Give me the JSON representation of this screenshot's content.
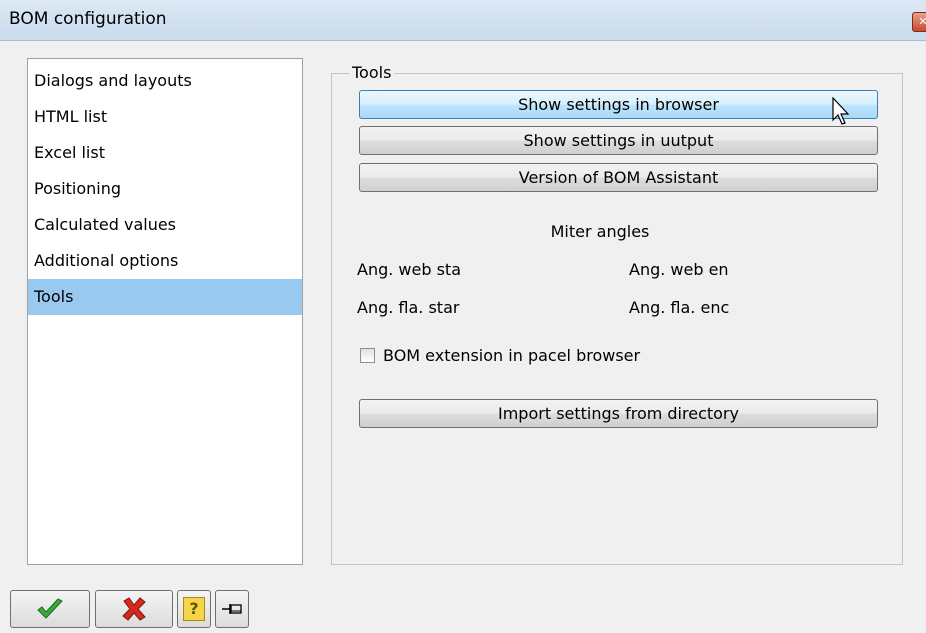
{
  "window": {
    "title": "BOM configuration",
    "close_glyph": "✕"
  },
  "sidebar": {
    "items": [
      {
        "label": "Dialogs and layouts",
        "selected": false
      },
      {
        "label": "HTML list",
        "selected": false
      },
      {
        "label": "Excel list",
        "selected": false
      },
      {
        "label": "Positioning",
        "selected": false
      },
      {
        "label": "Calculated values",
        "selected": false
      },
      {
        "label": "Additional options",
        "selected": false
      },
      {
        "label": "Tools",
        "selected": true
      }
    ]
  },
  "tools": {
    "group_title": "Tools",
    "show_browser_label": "Show settings in browser",
    "show_output_label": "Show settings in uutput",
    "version_label": "Version of BOM Assistant",
    "miter_title": "Miter angles",
    "ang_web_start": "Ang. web sta",
    "ang_web_end": "Ang. web en",
    "ang_fla_start": "Ang. fla. star",
    "ang_fla_end": "Ang. fla. enc",
    "bom_extension_label": "BOM extension in pacel browser",
    "bom_extension_checked": false,
    "import_label": "Import settings from directory"
  },
  "toolbar": {
    "icons": [
      "ok-check-icon",
      "cancel-x-icon",
      "help-icon",
      "pin-icon"
    ],
    "help_glyph": "?"
  },
  "colors": {
    "selection": "#99c9ef",
    "ok_green": "#3aa83a",
    "cancel_red": "#d42a1e",
    "help_yellow": "#f5d64a"
  }
}
